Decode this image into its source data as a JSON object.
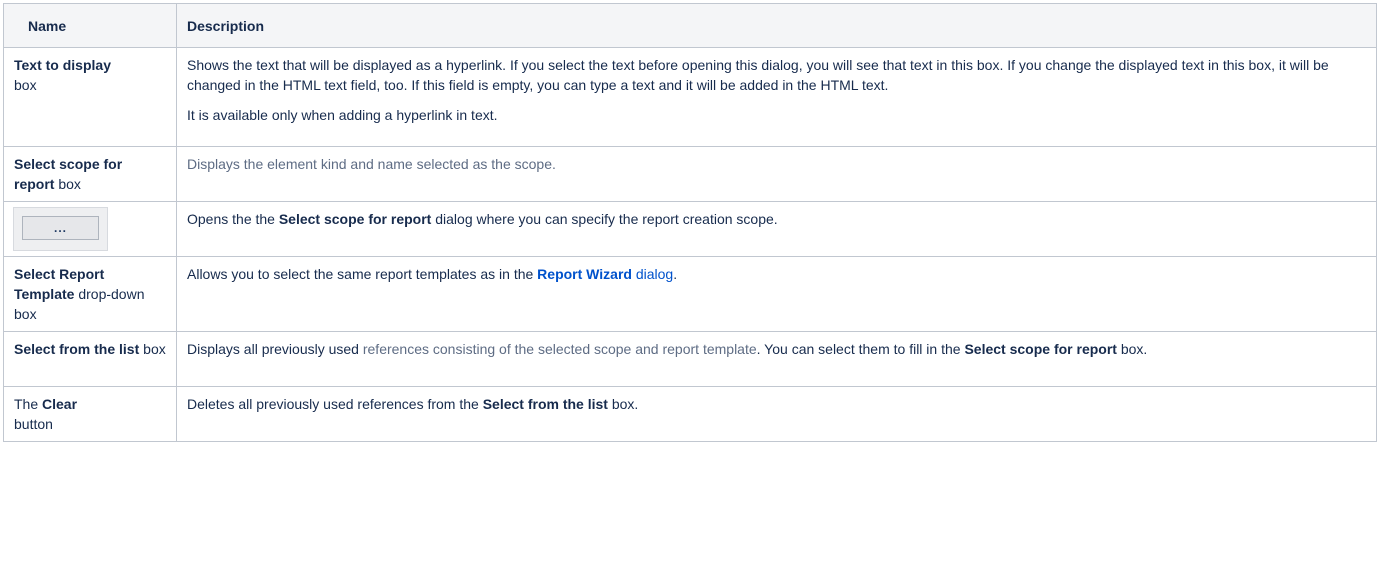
{
  "headers": {
    "name": "Name",
    "description": "Description"
  },
  "rows": [
    {
      "name_bold": "Text to display",
      "name_rest": "box",
      "p1": "Shows the text that will be displayed as a hyperlink. If you select the text before opening this dialog, you will see that text in this box. If you change the displayed text in this box, it will be changed in the HTML text field, too. If this field is empty, you can type a text and it will be added in the HTML text.",
      "p2": "It is available only when adding a hyperlink in text."
    },
    {
      "name_bold": "Select scope for report",
      "name_rest": "box",
      "desc": "Displays the element kind and name selected as the scope."
    },
    {
      "button_glyph": "...",
      "desc_pre": "Opens the the",
      "desc_bold": "Select scope for report",
      "desc_post": "dialog where you can specify the report creation scope."
    },
    {
      "name_bold": "Select Report Template",
      "name_rest": "drop-down box",
      "desc_pre": "Allows you to select the same report templates as in the",
      "link_bold": "Report Wizard",
      "link_rest": "dialog",
      "desc_end": "."
    },
    {
      "name_bold": "Select from the list",
      "name_rest": "box",
      "desc_pre": "Displays all previously used",
      "desc_grey": "references consisting of the selected scope and report template",
      "desc_mid": ". You can select them to fill in the",
      "desc_bold": "Select scope for report",
      "desc_post": "box."
    },
    {
      "name_pre": "The",
      "name_bold": "Clear",
      "name_rest": "button",
      "desc_pre": "Deletes all previously used references from the",
      "desc_bold": "Select from the list",
      "desc_post": "box."
    }
  ]
}
